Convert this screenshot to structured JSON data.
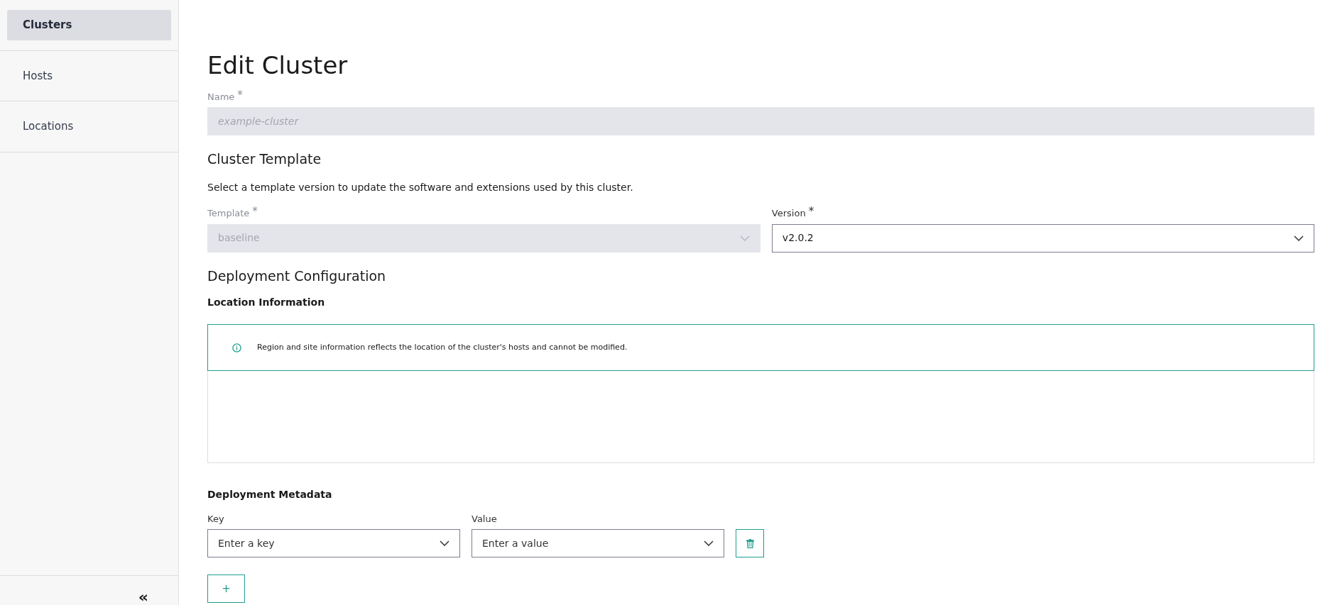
{
  "sidebar": {
    "items": [
      {
        "label": "Clusters",
        "selected": true
      },
      {
        "label": "Hosts",
        "selected": false
      },
      {
        "label": "Locations",
        "selected": false
      }
    ],
    "collapse": "«"
  },
  "page": {
    "title": "Edit Cluster",
    "name_field": {
      "label": "Name",
      "required_mark": "*",
      "placeholder": "example-cluster",
      "disabled": true
    },
    "template_section": {
      "heading": "Cluster Template",
      "description": "Select a template version to update the software and extensions used by this cluster.",
      "fields": [
        {
          "label": "Template",
          "required_mark": "*",
          "value": "baseline",
          "disabled": true
        },
        {
          "label": "Version",
          "required_mark": "*",
          "value": "v2.0.2",
          "disabled": false
        }
      ]
    },
    "deployment_section": {
      "heading": "Deployment Configuration",
      "location": {
        "heading": "Location Information",
        "notice": "Region and site information reflects the location of the cluster's hosts and cannot be modified."
      },
      "metadata": {
        "heading": "Deployment Metadata",
        "rows": [
          {
            "key_label": "Key",
            "key_placeholder": "Enter a key",
            "value_label": "Value",
            "value_placeholder": "Enter a value"
          }
        ],
        "add_button": "+"
      }
    }
  }
}
